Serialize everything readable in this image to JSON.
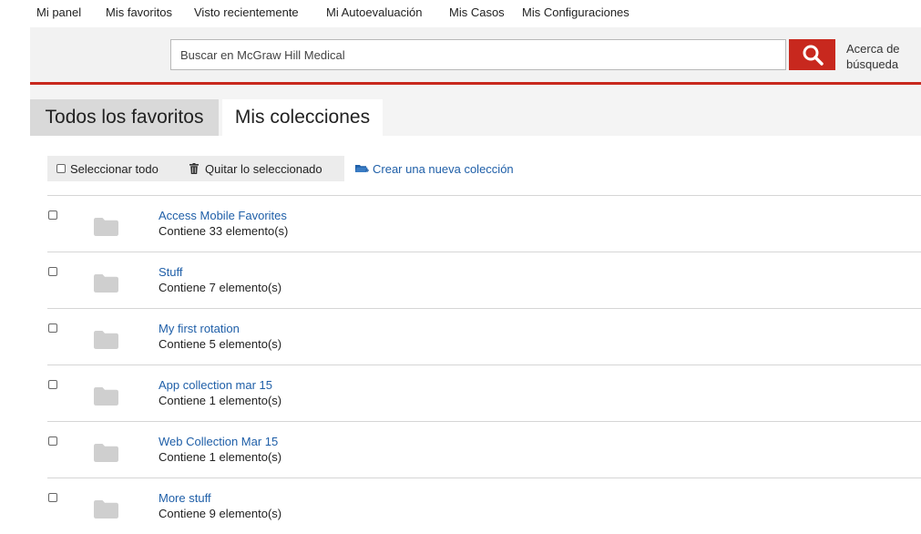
{
  "top_nav": [
    {
      "label": "Mi panel"
    },
    {
      "label": "Mis favoritos"
    },
    {
      "label": "Visto recientemente"
    },
    {
      "label": "Mi Autoevaluación"
    },
    {
      "label": "Mis Casos"
    },
    {
      "label": "Mis Configuraciones"
    }
  ],
  "search": {
    "placeholder": "Buscar en McGraw Hill Medical",
    "value": "",
    "help_line1": "Acerca de",
    "help_line2": "búsqueda"
  },
  "tabs": [
    {
      "label": "Todos los favoritos",
      "active": false
    },
    {
      "label": "Mis colecciones",
      "active": true
    }
  ],
  "toolbar": {
    "select_all": "Seleccionar todo",
    "remove_selected": "Quitar lo seleccionado",
    "new_collection": "Crear una nueva colección"
  },
  "collections": [
    {
      "name": "Access Mobile Favorites",
      "count": "Contiene 33 elemento(s)"
    },
    {
      "name": "Stuff",
      "count": "Contiene 7 elemento(s)"
    },
    {
      "name": "My first rotation",
      "count": "Contiene 5 elemento(s)"
    },
    {
      "name": "App collection mar 15",
      "count": "Contiene 1 elemento(s)"
    },
    {
      "name": "Web Collection Mar 15",
      "count": "Contiene 1 elemento(s)"
    },
    {
      "name": "More stuff",
      "count": "Contiene 9 elemento(s)"
    }
  ],
  "colors": {
    "brand_red": "#c8281e",
    "link_blue": "#1f5fa8",
    "folder_gray": "#cfcfcf"
  },
  "icons": {
    "search": "search-icon",
    "trash": "trash-icon",
    "new_folder": "folder-plus-icon",
    "folder": "folder-icon"
  }
}
